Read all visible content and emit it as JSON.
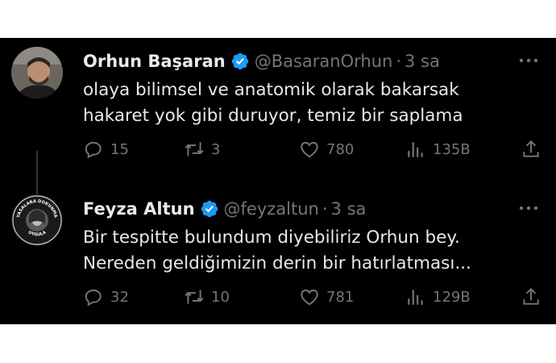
{
  "tweets": [
    {
      "name": "Orhun Başaran",
      "handle": "@BasaranOrhun",
      "separator": "·",
      "time": "3 sa",
      "lines": [
        "olaya bilimsel ve anatomik olarak bakarsak",
        "hakaret yok gibi duruyor, temiz bir saplama"
      ],
      "replies": "15",
      "retweets": "3",
      "likes": "780",
      "views": "135B"
    },
    {
      "name": "Feyza Altun",
      "handle": "@feyzaltun",
      "separator": "·",
      "time": "3 sa",
      "lines": [
        "Bir tespitte bulundum diyebiliriz Orhun bey.",
        "Nereden geldiğimizin derin bir hatırlatması..."
      ],
      "replies": "32",
      "retweets": "10",
      "likes": "781",
      "views": "129B",
      "avatar_text_top": "YASALARA DOKUNMA",
      "avatar_text_bottom": "UYGULA"
    }
  ],
  "icons": {
    "verified": "verified-badge-icon",
    "reply": "reply-icon",
    "retweet": "retweet-icon",
    "like": "heart-icon",
    "views": "views-icon",
    "share": "share-icon",
    "more": "more-icon"
  },
  "colors": {
    "background": "#000000",
    "text": "#e7e9ea",
    "muted": "#71767b",
    "verified": "#1d9bf0"
  }
}
